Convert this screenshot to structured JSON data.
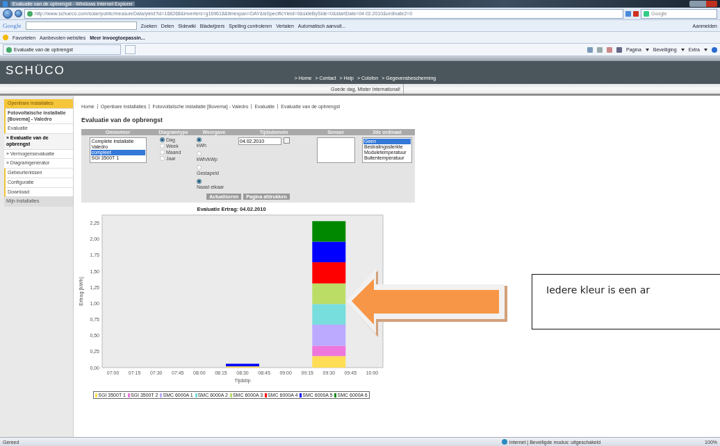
{
  "window": {
    "title": "Evaluatie van de opbrengst - Windows Internet Explorer"
  },
  "address_bar": {
    "url": "http://www.schueco.com/solar/public/measureData/yield?id=168268&inverters=g169618&timespan=DAY&isSpecificYield=0&sideBySide=0&startDate=04.02.2010&ordinate2=0",
    "search_placeholder": "Google"
  },
  "google_toolbar": {
    "logo": "Google",
    "buttons": [
      "Zoeken",
      "Delen",
      "Sidewiki",
      "Bladwijzers",
      "Spelling controleren",
      "Vertalen",
      "Automatisch aanvull..."
    ],
    "sign_in": "Aanmelden"
  },
  "favorites_bar": {
    "label": "Favorieten",
    "items": [
      "Aanbevolen websites",
      "Meer invoegtoepassin..."
    ]
  },
  "tab": {
    "label": "Evaluatie van de opbrengst"
  },
  "command_bar": [
    "Pagina",
    "Beveiliging",
    "Extra"
  ],
  "site_header": {
    "logo": "SCHÜCO",
    "nav": [
      "> Home",
      "> Contact",
      "> Help",
      "> Colofon",
      "> Gegevensbescherming"
    ],
    "greeting": "Goede dag,  Mister International!"
  },
  "sidebar": {
    "items": [
      {
        "label": "Openbare installaties",
        "kind": "header",
        "selected": false
      },
      {
        "label": "Fotovoltaïsche installatie [Bovema] - Valedro",
        "kind": "title",
        "selected": false
      },
      {
        "label": "Evaluatie",
        "kind": "section",
        "selected": false
      },
      {
        "label": "» Evaluatie van de opbrengst",
        "kind": "sub",
        "selected": true
      },
      {
        "label": "» Vermogensevaluatie",
        "kind": "sub",
        "selected": false
      },
      {
        "label": "» Diagramgenerator",
        "kind": "sub",
        "selected": false
      },
      {
        "label": "Gebeurtenissen",
        "kind": "section",
        "selected": false
      },
      {
        "label": "Configuratie",
        "kind": "section",
        "selected": false
      },
      {
        "label": "Download",
        "kind": "section",
        "selected": false
      },
      {
        "label": "Mijn installaties",
        "kind": "footer",
        "selected": false
      }
    ]
  },
  "breadcrumb": [
    "Home",
    "Openbare installaties",
    "Fotovoltaïsche installatie [Bovema] - Valedro",
    "Evaluatie",
    "Evaluatie van de opbrengst"
  ],
  "page_title": "Evaluatie van de opbrengst",
  "form": {
    "headers": [
      "Omvormer",
      "Diagramtype",
      "Weergave",
      "Tijdsdomein",
      "Sensor",
      "2de ordinaat"
    ],
    "inverters": [
      {
        "label": "Complete installatie",
        "selected": false
      },
      {
        "label": "Valedro",
        "selected": false
      },
      {
        "label": "compleet",
        "selected": true
      },
      {
        "label": "SGI 3500T 1",
        "selected": false
      }
    ],
    "diagram_types": [
      {
        "label": "Dag",
        "selected": true
      },
      {
        "label": "Week",
        "selected": false
      },
      {
        "label": "Maand",
        "selected": false
      },
      {
        "label": "Jaar",
        "selected": false
      }
    ],
    "units": [
      {
        "label": "kWh",
        "selected": true
      },
      {
        "label": "kWh/kWp",
        "selected": false
      }
    ],
    "arrangement": [
      {
        "label": "Gestapeld",
        "selected": false
      },
      {
        "label": "Naast elkaar",
        "selected": true
      }
    ],
    "date": "04.02.2010",
    "ordinates": [
      {
        "label": "Geen",
        "selected": true
      },
      {
        "label": "Bestralingssterkte",
        "selected": false
      },
      {
        "label": "Moduletemperatuur",
        "selected": false
      },
      {
        "label": "Buitentemperatuur",
        "selected": false
      }
    ],
    "buttons": [
      "Actualiseren",
      "Pagina afdrukken"
    ]
  },
  "chart_data": {
    "type": "bar",
    "stacked": true,
    "title": "Evaluatie  Ertrag: 04.02.2010",
    "xlabel": "Tijdstip",
    "ylabel": "Ertrag [kWh]",
    "categories": [
      "07:00",
      "07:15",
      "07:30",
      "07:45",
      "08:00",
      "08:15",
      "08:30",
      "08:45",
      "09:00",
      "09:15",
      "09:30",
      "09:45",
      "10:00"
    ],
    "series": [
      {
        "name": "SGI 3500T 1",
        "color": "#ffdd55",
        "values": [
          null,
          null,
          null,
          null,
          null,
          null,
          0.02,
          null,
          null,
          null,
          0.18,
          null,
          null
        ]
      },
      {
        "name": "SGI 3500T 2",
        "color": "#ee77dd",
        "values": [
          null,
          null,
          null,
          null,
          null,
          null,
          null,
          null,
          null,
          null,
          0.16,
          null,
          null
        ]
      },
      {
        "name": "SMC 6000A 1",
        "color": "#bbaaff",
        "values": [
          null,
          null,
          null,
          null,
          null,
          null,
          null,
          null,
          null,
          null,
          0.33,
          null,
          null
        ]
      },
      {
        "name": "SMC 6000A 2",
        "color": "#77dddd",
        "values": [
          null,
          null,
          null,
          null,
          null,
          null,
          null,
          null,
          null,
          null,
          0.32,
          null,
          null
        ]
      },
      {
        "name": "SMC 6000A 3",
        "color": "#bbdd66",
        "values": [
          null,
          null,
          null,
          null,
          null,
          null,
          null,
          null,
          null,
          null,
          0.32,
          null,
          null
        ]
      },
      {
        "name": "SMC 6000A 4",
        "color": "#ff0000",
        "values": [
          null,
          null,
          null,
          null,
          null,
          null,
          null,
          null,
          null,
          null,
          0.33,
          null,
          null
        ]
      },
      {
        "name": "SMC 6000A 5",
        "color": "#0000ff",
        "values": [
          null,
          null,
          null,
          null,
          null,
          null,
          0.04,
          null,
          null,
          null,
          0.32,
          null,
          null
        ]
      },
      {
        "name": "SMC 6000A 6",
        "color": "#008800",
        "values": [
          null,
          null,
          null,
          null,
          null,
          null,
          null,
          null,
          null,
          null,
          0.32,
          null,
          null
        ]
      }
    ],
    "legend": "bottom",
    "ylim": [
      0,
      2.375
    ],
    "yticks": [
      {
        "value": 0,
        "label": "0,00"
      },
      {
        "value": 0.25,
        "label": "0,25"
      },
      {
        "value": 0.5,
        "label": "0,50"
      },
      {
        "value": 0.75,
        "label": "0,75"
      },
      {
        "value": 1,
        "label": "1,00"
      },
      {
        "value": 1.25,
        "label": "1,25"
      },
      {
        "value": 1.5,
        "label": "1,50"
      },
      {
        "value": 1.75,
        "label": "1,75"
      },
      {
        "value": 2,
        "label": "2,00"
      },
      {
        "value": 2.25,
        "label": "2,25"
      }
    ]
  },
  "callout": {
    "text": "Iedere kleur is een ar"
  },
  "status_bar": {
    "left": "Gereed",
    "zone": "Internet | Beveiligde modus: uitgeschakeld",
    "zoom": "100%"
  }
}
